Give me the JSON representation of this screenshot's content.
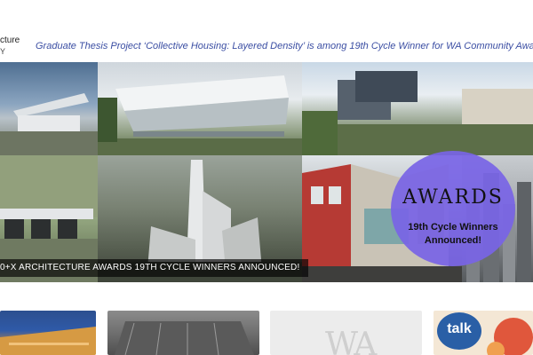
{
  "header": {
    "logo_line1": "cture",
    "logo_line2": "Y",
    "headline": "Graduate Thesis Project ‘Collective Housing: Layered Density’ is among 19th Cycle Winner for WA Community Award!"
  },
  "hero": {
    "caption": "0+X ARCHITECTURE AWARDS 19TH CYCLE WINNERS ANNOUNCED!",
    "badge": {
      "brand": "AWARDS",
      "line1": "19th Cycle Winners",
      "line2": "Announced!"
    }
  },
  "cards": [
    {
      "label": ""
    },
    {
      "label": ""
    },
    {
      "mark": "WA"
    },
    {
      "badge": "talk"
    }
  ],
  "colors": {
    "headline": "#3b4ea3",
    "badge": "#7864e6",
    "caption_bg": "#000000"
  }
}
